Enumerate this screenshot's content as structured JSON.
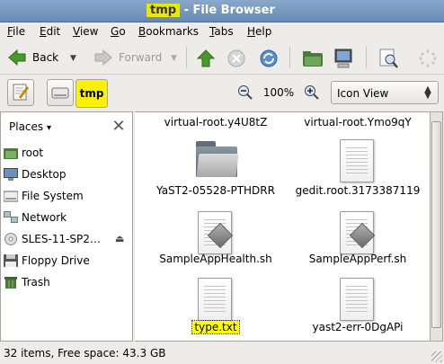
{
  "window": {
    "title_highlight": "tmp",
    "title_rest": " - File Browser"
  },
  "menu": [
    {
      "mnemonic": "F",
      "rest": "ile"
    },
    {
      "mnemonic": "E",
      "rest": "dit"
    },
    {
      "mnemonic": "V",
      "rest": "iew"
    },
    {
      "mnemonic": "G",
      "rest": "o"
    },
    {
      "mnemonic": "B",
      "rest": "ookmarks"
    },
    {
      "mnemonic": "T",
      "rest": "abs"
    },
    {
      "mnemonic": "H",
      "rest": "elp"
    }
  ],
  "toolbar": {
    "back_label": "Back",
    "forward_label": "Forward"
  },
  "location": {
    "crumb": "tmp",
    "zoom": "100%",
    "view_mode": "Icon View"
  },
  "sidebar": {
    "header": "Places",
    "items": [
      {
        "label": "root",
        "icon": "home-folder-icon"
      },
      {
        "label": "Desktop",
        "icon": "desktop-icon"
      },
      {
        "label": "File System",
        "icon": "harddisk-icon"
      },
      {
        "label": "Network",
        "icon": "network-icon"
      },
      {
        "label": "SLES-11-SP2…",
        "icon": "cdrom-icon"
      },
      {
        "label": "Floppy Drive",
        "icon": "floppy-icon"
      },
      {
        "label": "Trash",
        "icon": "trash-icon"
      }
    ]
  },
  "files": [
    {
      "name": "virtual-root.y4U8tZ",
      "type": "partial"
    },
    {
      "name": "virtual-root.Ymo9qY",
      "type": "partial"
    },
    {
      "name": "YaST2-05528-PTHDRR",
      "type": "folder"
    },
    {
      "name": "gedit.root.3173387119",
      "type": "text"
    },
    {
      "name": "SampleAppHealth.sh",
      "type": "script"
    },
    {
      "name": "SampleAppPerf.sh",
      "type": "script"
    },
    {
      "name": "type.txt",
      "type": "text",
      "selected": true
    },
    {
      "name": "yast2-err-0DgAPi",
      "type": "text"
    }
  ],
  "status": "32 items, Free space: 43.3 GB",
  "colors": {
    "highlight": "#ffff00",
    "titlebar": "#6789b4"
  }
}
